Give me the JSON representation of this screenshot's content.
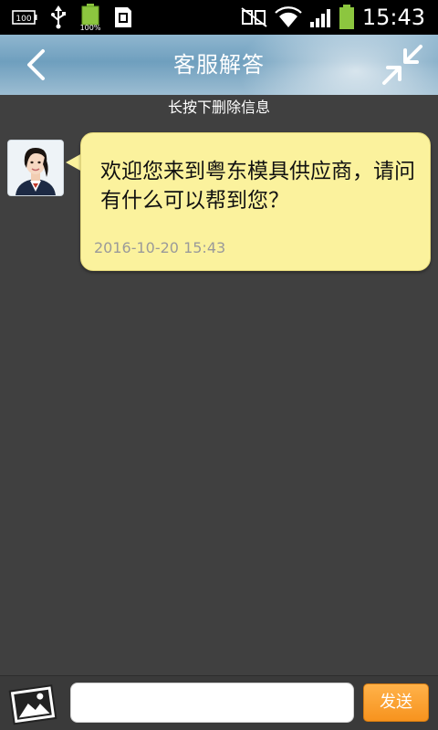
{
  "status_bar": {
    "time": "15:43",
    "left_icons": [
      "battery-100-icon",
      "usb-icon",
      "battery-charging-icon",
      "sim-icon"
    ],
    "left_labels": {
      "battery_level": "100",
      "charging_percent": "100%"
    },
    "right_icons": [
      "nfc-icon",
      "wifi-icon",
      "signal-icon",
      "battery-icon"
    ],
    "colors": {
      "accent": "#8cc63f"
    }
  },
  "title_bar": {
    "title": "客服解答",
    "back_icon": "back-arrow-icon",
    "collapse_icon": "collapse-arrows-icon"
  },
  "hint": "长按下删除信息",
  "messages": [
    {
      "sender": "agent",
      "avatar_icon": "agent-avatar",
      "text": "欢迎您来到粤东模具供应商，请问有什么可以帮到您？",
      "time": "2016-10-20 15:43"
    }
  ],
  "input_bar": {
    "image_icon": "image-icon",
    "input_value": "",
    "input_placeholder": "",
    "send_label": "发送",
    "send_color": "#f7931e"
  }
}
